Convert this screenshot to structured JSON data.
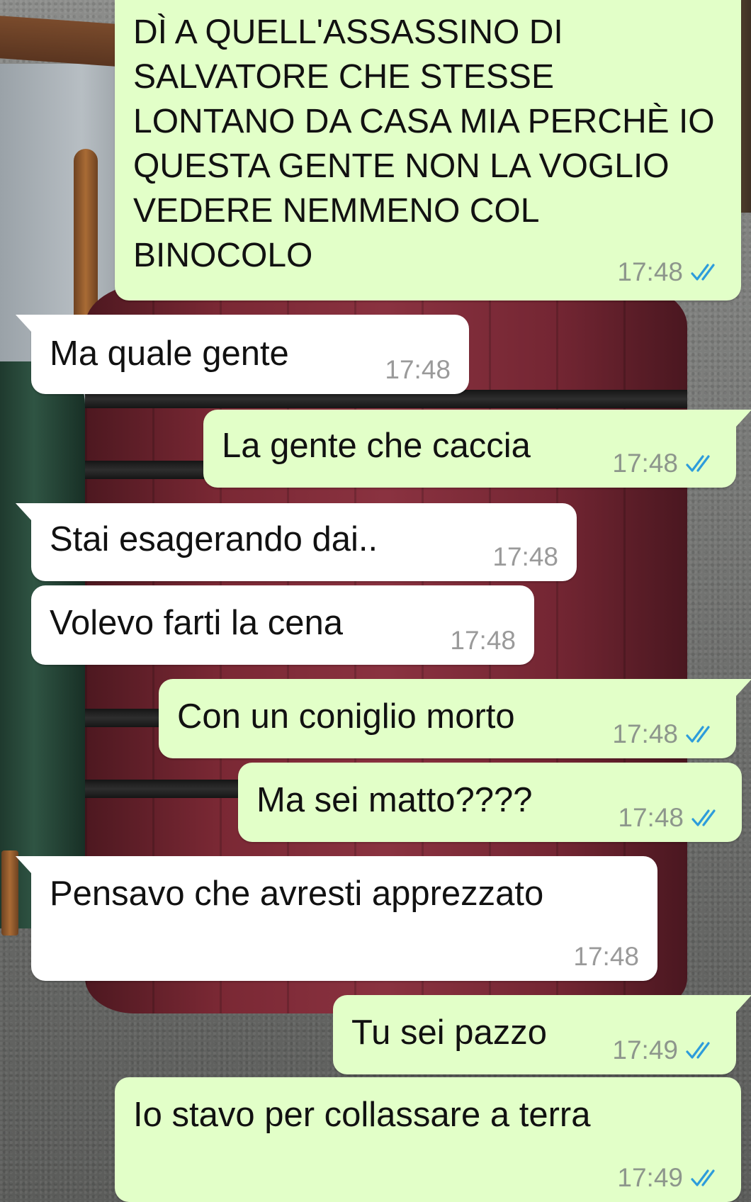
{
  "theme": {
    "incoming_bubble": "#ffffff",
    "outgoing_bubble": "#e2ffc8",
    "read_ticks_color": "#2d9cdb",
    "timestamp_color": "#8d968c"
  },
  "messages": [
    {
      "direction": "outgoing",
      "text": "DÌ A QUELL'ASSASSINO DI SALVATORE CHE STESSE LONTANO DA CASA MIA PERCHÈ IO QUESTA GENTE NON LA VOGLIO VEDERE NEMMENO COL BINOCOLO",
      "time": "17:48",
      "status_icon": "double-check-icon"
    },
    {
      "direction": "incoming",
      "text": "Ma quale gente",
      "time": "17:48"
    },
    {
      "direction": "outgoing",
      "text": "La gente che caccia",
      "time": "17:48",
      "status_icon": "double-check-icon"
    },
    {
      "direction": "incoming",
      "text": "Stai esagerando dai..",
      "time": "17:48"
    },
    {
      "direction": "incoming",
      "text": "Volevo farti la cena",
      "time": "17:48"
    },
    {
      "direction": "outgoing",
      "text": "Con un coniglio morto",
      "time": "17:48",
      "status_icon": "double-check-icon"
    },
    {
      "direction": "outgoing",
      "text": "Ma sei matto????",
      "time": "17:48",
      "status_icon": "double-check-icon"
    },
    {
      "direction": "incoming",
      "text": "Pensavo che avresti apprezzato",
      "time": "17:48"
    },
    {
      "direction": "outgoing",
      "text": "Tu sei pazzo",
      "time": "17:49",
      "status_icon": "double-check-icon"
    },
    {
      "direction": "outgoing",
      "text": "Io stavo per collassare a terra",
      "time": "17:49",
      "status_icon": "double-check-icon"
    }
  ]
}
